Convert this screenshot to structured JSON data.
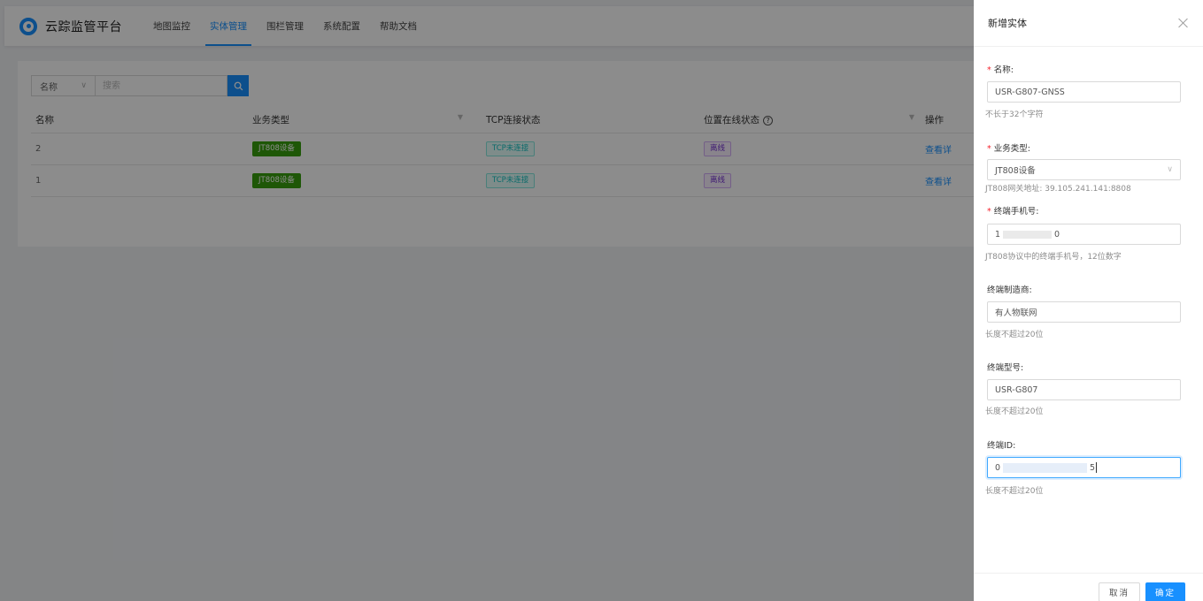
{
  "app": {
    "title": "云踪监管平台",
    "nav": [
      "地图监控",
      "实体管理",
      "围栏管理",
      "系统配置",
      "帮助文档"
    ],
    "active_nav": "实体管理"
  },
  "search": {
    "field_select": "名称",
    "placeholder": "搜索"
  },
  "table": {
    "headers": {
      "name": "名称",
      "type": "业务类型",
      "tcp": "TCP连接状态",
      "location": "位置在线状态",
      "action": "操作"
    },
    "rows": [
      {
        "name": "2",
        "type": "JT808设备",
        "tcp": "TCP未连接",
        "location": "离线",
        "action": "查看详"
      },
      {
        "name": "1",
        "type": "JT808设备",
        "tcp": "TCP未连接",
        "location": "离线",
        "action": "查看详"
      }
    ]
  },
  "drawer": {
    "title": "新增实体",
    "fields": {
      "name": {
        "label": "名称:",
        "value": "USR-G807-GNSS",
        "help": "不长于32个字符"
      },
      "type": {
        "label": "业务类型:",
        "value": "JT808设备",
        "help": "JT808网关地址: 39.105.241.141:8808"
      },
      "phone": {
        "label": "终端手机号:",
        "value_prefix": "1",
        "value_suffix": "0",
        "help": "JT808协议中的终端手机号，12位数字"
      },
      "maker": {
        "label": "终端制造商:",
        "value": "有人物联网",
        "help": "长度不超过20位"
      },
      "model": {
        "label": "终端型号:",
        "value": "USR-G807",
        "help": "长度不超过20位"
      },
      "terminal_id": {
        "label": "终端ID:",
        "value_prefix": "0",
        "value_suffix": "5",
        "help": "长度不超过20位"
      }
    },
    "cancel": "取消",
    "ok": "确定"
  },
  "colors": {
    "primary": "#1890ff",
    "tag_green": "#389e0d",
    "tag_cyan": "#13c2c2",
    "tag_purple": "#722ed1",
    "required": "#f5222d"
  }
}
